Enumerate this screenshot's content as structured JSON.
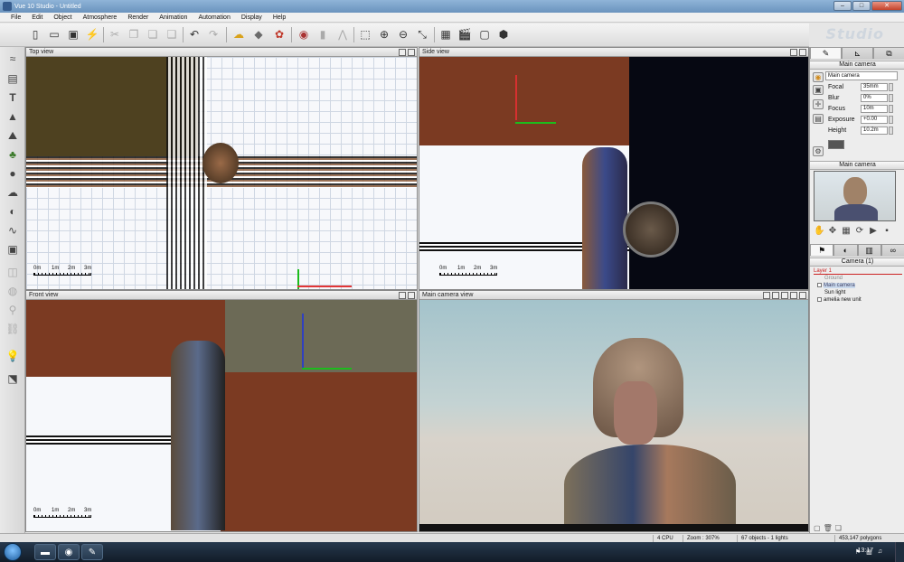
{
  "window": {
    "title": "Vue 10 Studio - Untitled",
    "controls": [
      "–",
      "□",
      "✕"
    ]
  },
  "menu": [
    "File",
    "Edit",
    "Object",
    "Atmosphere",
    "Render",
    "Animation",
    "Automation",
    "Display",
    "Help"
  ],
  "toolbar_icons": [
    "new-icon",
    "open-icon",
    "save-icon",
    "render-icon",
    "cut-icon",
    "copy-icon",
    "paste-icon",
    "duplicate-icon",
    "undo-icon",
    "redo-icon",
    "atmosphere-icon",
    "object-icon",
    "material-icon",
    "preview-icon",
    "align-icon",
    "drop-icon",
    "zoom-region-icon",
    "zoom-in-icon",
    "zoom-out-icon",
    "fit-icon",
    "render-area-icon",
    "animation-icon",
    "frame-icon",
    "camera-manager-icon"
  ],
  "brand": "Studio",
  "viewports": {
    "top": "Top view",
    "side": "Side view",
    "front": "Front view",
    "camera": "Main camera view"
  },
  "scale_labels": [
    "0m",
    "1m",
    "2m",
    "3m"
  ],
  "camera_panel": {
    "title": "Main camera",
    "selected_camera": "Main camera",
    "props": [
      {
        "label": "Focal",
        "value": "35mm"
      },
      {
        "label": "Blur",
        "value": "0%"
      },
      {
        "label": "Focus",
        "value": "10m"
      },
      {
        "label": "Exposure",
        "value": "+0.00"
      },
      {
        "label": "Height",
        "value": "10.2m"
      }
    ]
  },
  "preview_title": "Main camera",
  "world_title": "Camera (1)",
  "tree": {
    "layer": "Layer 1",
    "items": [
      "Ground",
      "Main camera",
      "Sun light",
      "amelia new unit"
    ]
  },
  "status": {
    "cpu": "4 CPU",
    "zoom": "Zoom : 307%",
    "objects": "67 objects - 1 lights",
    "polygons": "453,147 polygons"
  },
  "taskbar": {
    "time": "13:17"
  },
  "colors": {
    "dark_brown": "#4e4120",
    "rust": "#7b3a22",
    "sky": "#9cc1cb"
  }
}
